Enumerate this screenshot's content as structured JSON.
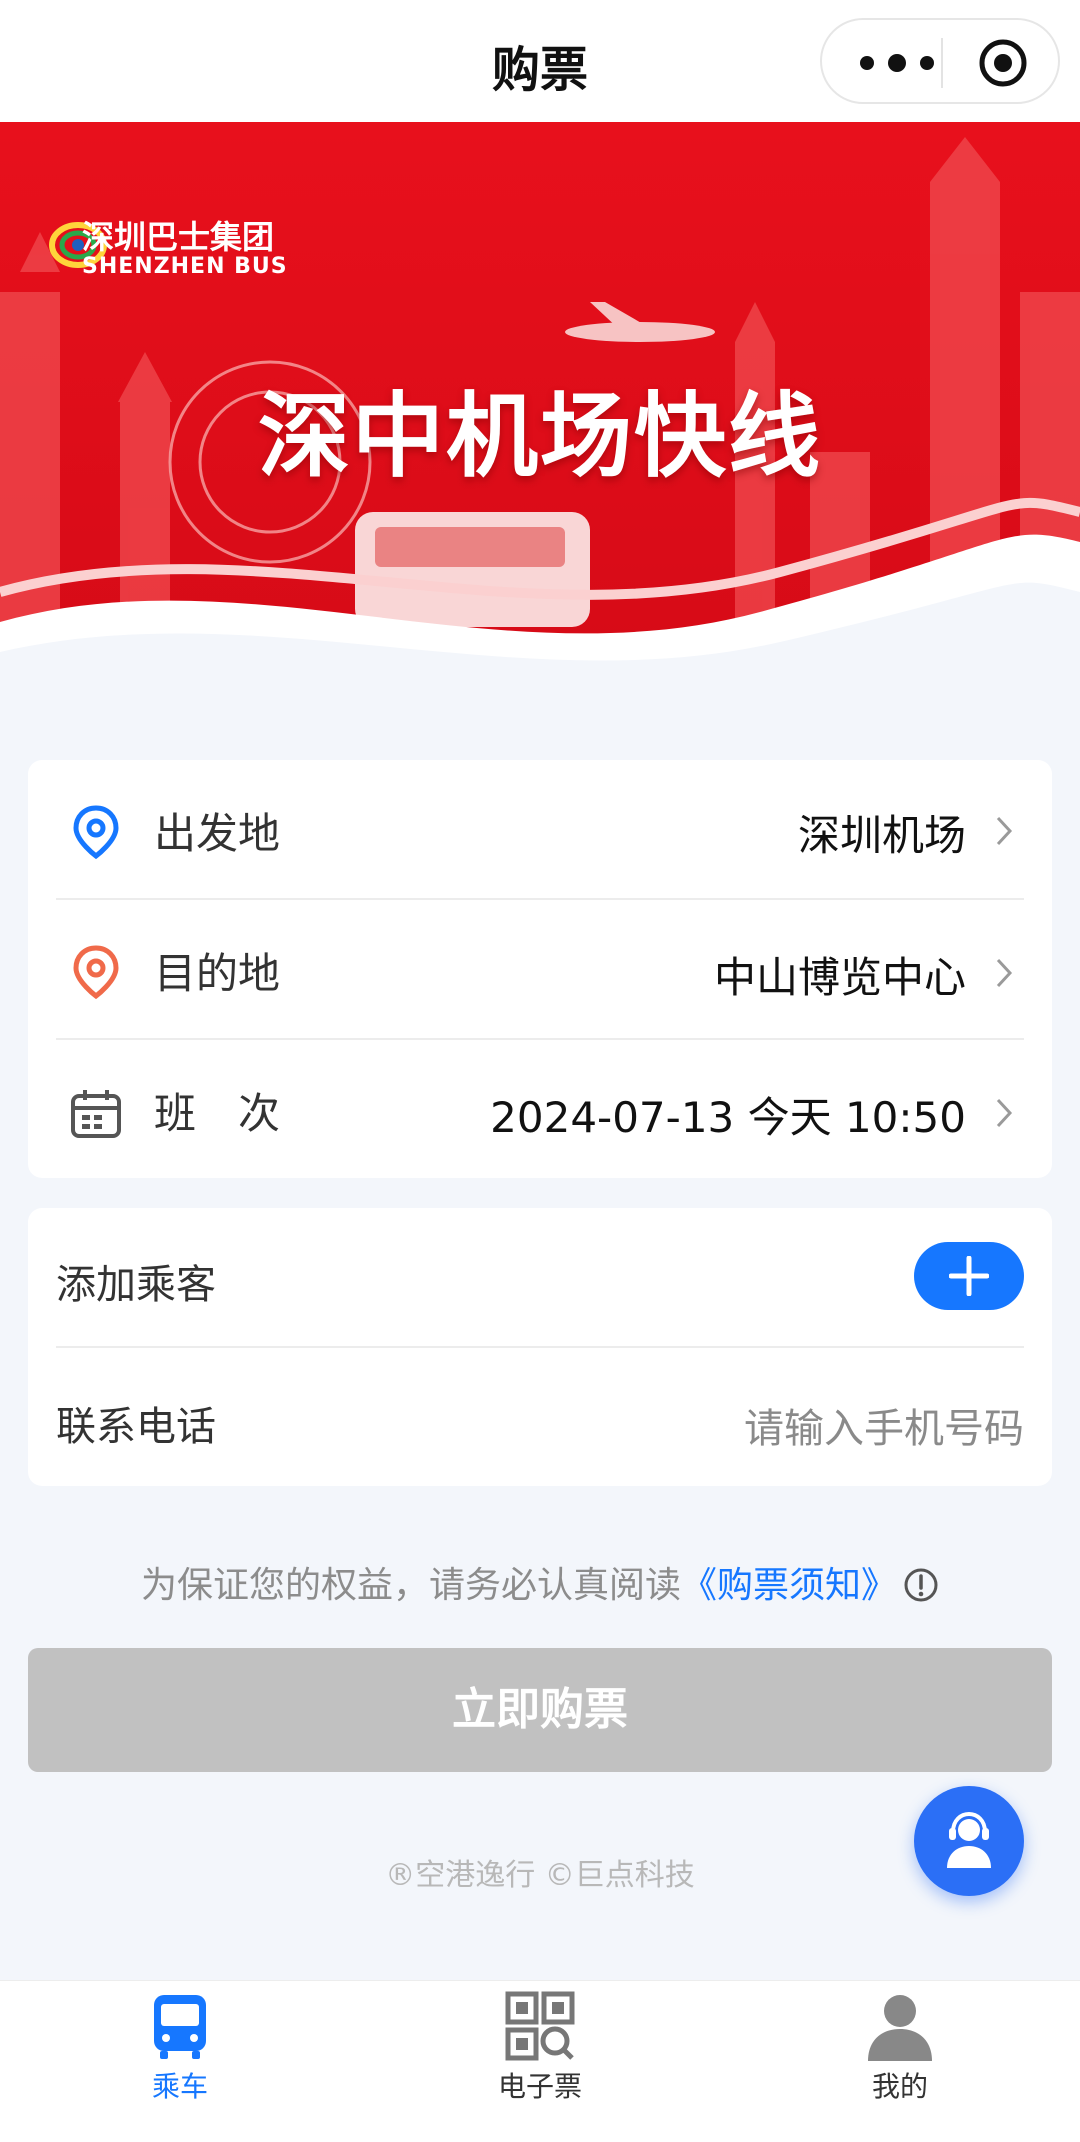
{
  "header": {
    "title": "购票"
  },
  "banner": {
    "title": "深中机场快线",
    "logo_cn": "深圳巴士集团",
    "logo_en": "SHENZHEN BUS"
  },
  "trip": {
    "departure_label": "出发地",
    "departure_value": "深圳机场",
    "destination_label": "目的地",
    "destination_value": "中山博览中心",
    "schedule_label": "班　次",
    "schedule_value": "2024-07-13 今天 10:50"
  },
  "passenger": {
    "add_label": "添加乘客",
    "phone_label": "联系电话",
    "phone_placeholder": "请输入手机号码"
  },
  "notice": {
    "text": "为保证您的权益，请务必认真阅读",
    "link": "《购票须知》"
  },
  "buy_button": "立即购票",
  "footer": "®空港逸行 ©巨点科技",
  "tabs": [
    {
      "label": "乘车",
      "icon": "bus-icon",
      "active": true
    },
    {
      "label": "电子票",
      "icon": "qr-ticket-icon",
      "active": false
    },
    {
      "label": "我的",
      "icon": "user-icon",
      "active": false
    }
  ],
  "colors": {
    "accent": "#1677ff",
    "banner_red": "#e3101d",
    "disabled_button": "#c1c1c1",
    "page_bg": "#f3f6fb"
  }
}
